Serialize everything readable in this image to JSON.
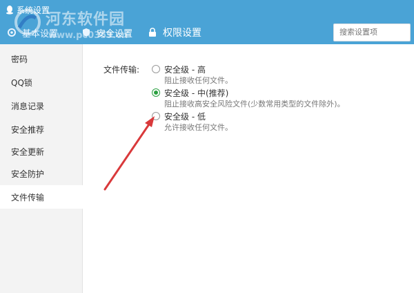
{
  "window": {
    "title": "系统设置"
  },
  "watermark": {
    "site_name": "河东软件园",
    "url": "www.pc0359.cn"
  },
  "tabs": [
    {
      "label": "基本设置",
      "icon": "gear-icon"
    },
    {
      "label": "安全设置",
      "icon": "shield-icon"
    },
    {
      "label": "权限设置",
      "icon": "lock-icon"
    }
  ],
  "search": {
    "placeholder": "搜索设置项"
  },
  "sidebar": {
    "items": [
      {
        "label": "密码"
      },
      {
        "label": "QQ锁"
      },
      {
        "label": "消息记录"
      },
      {
        "label": "安全推荐"
      },
      {
        "label": "安全更新"
      },
      {
        "label": "安全防护"
      },
      {
        "label": "文件传输",
        "active": true
      }
    ]
  },
  "main": {
    "section_label": "文件传输:",
    "options": [
      {
        "title": "安全级 - 高",
        "desc": "阻止接收任何文件。",
        "checked": false
      },
      {
        "title": "安全级 - 中(推荐)",
        "desc": "阻止接收高安全风险文件(少数常用类型的文件除外)。",
        "checked": true
      },
      {
        "title": "安全级 - 低",
        "desc": "允许接收任何文件。",
        "checked": false
      }
    ]
  },
  "colors": {
    "header": "#4aa3d6",
    "radio_checked": "#2aa040",
    "arrow": "#d9393b"
  }
}
